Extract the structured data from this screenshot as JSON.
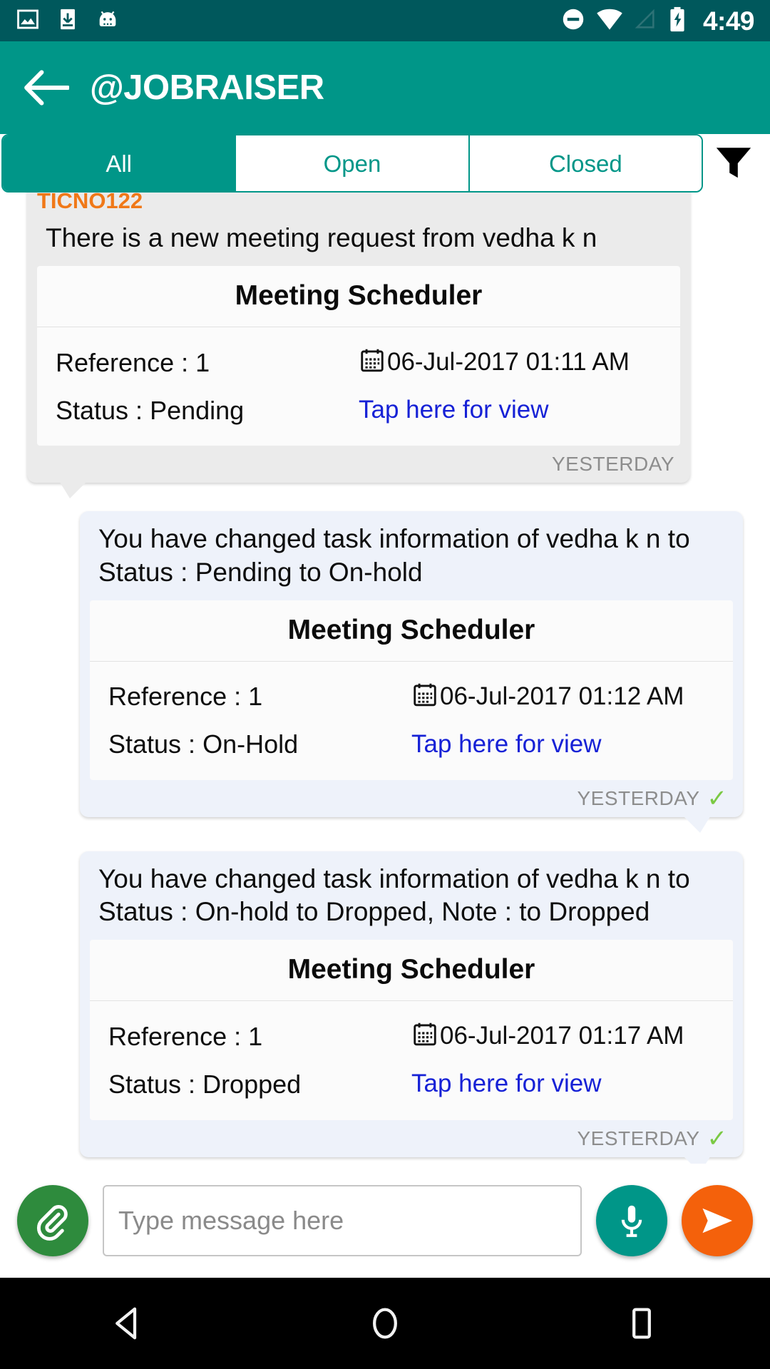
{
  "status_bar": {
    "icons": [
      "image-icon",
      "download-icon",
      "android-head-icon",
      "do-not-disturb-icon",
      "wifi-icon",
      "cell-signal-icon",
      "battery-charging-icon"
    ],
    "clock": "4:49",
    "background_color": "#00585c"
  },
  "app_bar": {
    "back_icon": "arrow-left-icon",
    "title": "@JOBRAISER",
    "background_color": "#009688"
  },
  "tabs": {
    "items": [
      {
        "label": "All",
        "active": true
      },
      {
        "label": "Open",
        "active": false
      },
      {
        "label": "Closed",
        "active": false
      }
    ],
    "filter_icon": "filter-funnel-icon",
    "accent_color": "#009688"
  },
  "messages": [
    {
      "direction": "incoming",
      "ticket_id": "TICNO122",
      "ticket_id_color": "#f07818",
      "text": "There is a new meeting request from vedha k n",
      "card": {
        "title": "Meeting Scheduler",
        "reference_label": "Reference : 1",
        "date_icon": "calendar-icon",
        "date": "06-Jul-2017 01:11 AM",
        "status_label": "Status : Pending",
        "action_label": "Tap here for view",
        "action_color": "#1621d6"
      },
      "meta": {
        "time": "YESTERDAY",
        "delivered": false
      }
    },
    {
      "direction": "outgoing",
      "ticket_id": "",
      "text": "You have changed task information of vedha k n  to Status : Pending to On-hold",
      "card": {
        "title": "Meeting Scheduler",
        "reference_label": "Reference : 1",
        "date_icon": "calendar-icon",
        "date": "06-Jul-2017 01:12 AM",
        "status_label": "Status : On-Hold",
        "action_label": "Tap here for view",
        "action_color": "#1621d6"
      },
      "meta": {
        "time": "YESTERDAY",
        "delivered": true,
        "tick": "✓"
      }
    },
    {
      "direction": "outgoing",
      "ticket_id": "",
      "text": "You have changed task information of vedha k n  to Status : On-hold to Dropped, Note :  to Dropped",
      "card": {
        "title": "Meeting Scheduler",
        "reference_label": "Reference : 1",
        "date_icon": "calendar-icon",
        "date": "06-Jul-2017 01:17 AM",
        "status_label": "Status : Dropped",
        "action_label": "Tap here for view",
        "action_color": "#1621d6"
      },
      "meta": {
        "time": "YESTERDAY",
        "delivered": true,
        "tick": "✓"
      }
    }
  ],
  "input_bar": {
    "attach_icon": "paperclip-icon",
    "attach_color": "#2e8b3d",
    "placeholder": "Type message here",
    "value": "",
    "mic_icon": "microphone-icon",
    "mic_color": "#009688",
    "send_icon": "send-paper-plane-icon",
    "send_color": "#f4610b"
  },
  "nav_bar": {
    "back_icon": "nav-back-triangle-icon",
    "home_icon": "nav-home-circle-icon",
    "recents_icon": "nav-recents-square-icon",
    "background_color": "#000000"
  }
}
